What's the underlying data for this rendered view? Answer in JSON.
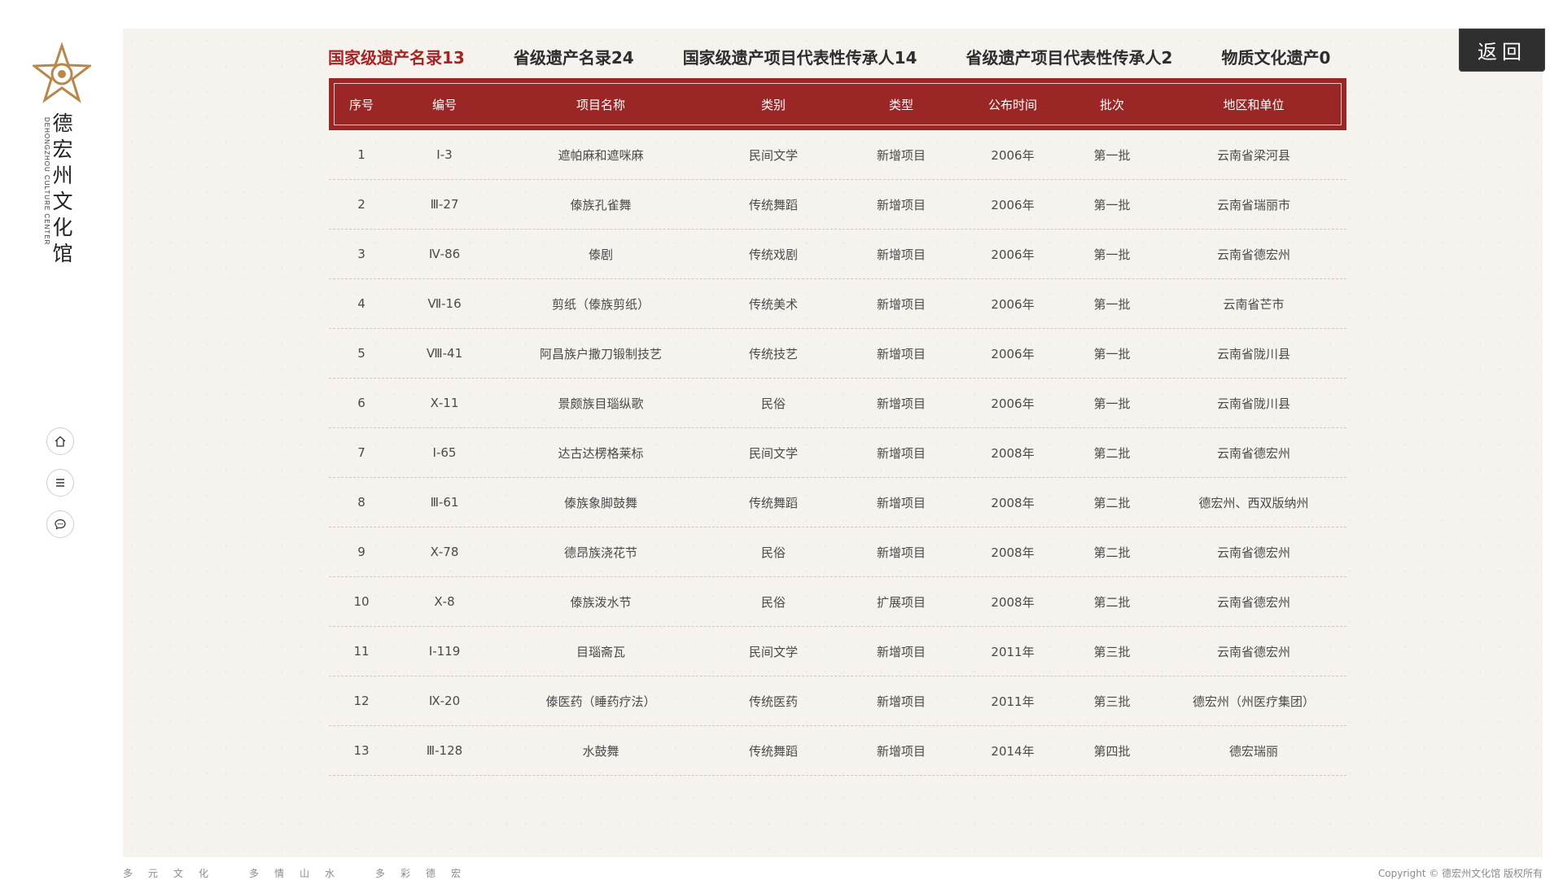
{
  "logo": {
    "name_cn": [
      "德",
      "宏",
      "州",
      "文",
      "化",
      "馆"
    ],
    "name_en": "DEHONGZHOU CULTURE CENTER"
  },
  "nav": [
    {
      "icon": "home-icon"
    },
    {
      "icon": "menu-icon"
    },
    {
      "icon": "chat-icon"
    }
  ],
  "tabs": [
    {
      "label": "国家级遗产名录13",
      "active": true
    },
    {
      "label": "省级遗产名录24",
      "active": false
    },
    {
      "label": "国家级遗产项目代表性传承人14",
      "active": false
    },
    {
      "label": "省级遗产项目代表性传承人2",
      "active": false
    },
    {
      "label": "物质文化遗产0",
      "active": false
    }
  ],
  "back_label": "返回",
  "table": {
    "headers": [
      "序号",
      "编号",
      "项目名称",
      "类别",
      "类型",
      "公布时间",
      "批次",
      "地区和单位"
    ],
    "rows": [
      [
        "1",
        "Ⅰ-3",
        "遮帕麻和遮咪麻",
        "民间文学",
        "新增项目",
        "2006年",
        "第一批",
        "云南省梁河县"
      ],
      [
        "2",
        "Ⅲ-27",
        "傣族孔雀舞",
        "传统舞蹈",
        "新增项目",
        "2006年",
        "第一批",
        "云南省瑞丽市"
      ],
      [
        "3",
        "Ⅳ-86",
        "傣剧",
        "传统戏剧",
        "新增项目",
        "2006年",
        "第一批",
        "云南省德宏州"
      ],
      [
        "4",
        "Ⅶ-16",
        "剪纸（傣族剪纸）",
        "传统美术",
        "新增项目",
        "2006年",
        "第一批",
        "云南省芒市"
      ],
      [
        "5",
        "Ⅷ-41",
        "阿昌族户撒刀锻制技艺",
        "传统技艺",
        "新增项目",
        "2006年",
        "第一批",
        "云南省陇川县"
      ],
      [
        "6",
        "Ⅹ-11",
        "景颇族目瑙纵歌",
        "民俗",
        "新增项目",
        "2006年",
        "第一批",
        "云南省陇川县"
      ],
      [
        "7",
        "Ⅰ-65",
        "达古达楞格莱标",
        "民间文学",
        "新增项目",
        "2008年",
        "第二批",
        "云南省德宏州"
      ],
      [
        "8",
        "Ⅲ-61",
        "傣族象脚鼓舞",
        "传统舞蹈",
        "新增项目",
        "2008年",
        "第二批",
        "德宏州、西双版纳州"
      ],
      [
        "9",
        "Ⅹ-78",
        "德昂族浇花节",
        "民俗",
        "新增项目",
        "2008年",
        "第二批",
        "云南省德宏州"
      ],
      [
        "10",
        "Ⅹ-8",
        "傣族泼水节",
        "民俗",
        "扩展项目",
        "2008年",
        "第二批",
        "云南省德宏州"
      ],
      [
        "11",
        "Ⅰ-119",
        "目瑙斋瓦",
        "民间文学",
        "新增项目",
        "2011年",
        "第三批",
        "云南省德宏州"
      ],
      [
        "12",
        "Ⅸ-20",
        "傣医药（睡药疗法）",
        "传统医药",
        "新增项目",
        "2011年",
        "第三批",
        "德宏州（州医疗集团）"
      ],
      [
        "13",
        "Ⅲ-128",
        "水鼓舞",
        "传统舞蹈",
        "新增项目",
        "2014年",
        "第四批",
        "德宏瑞丽"
      ]
    ]
  },
  "footer": {
    "slogan": "多元文化　多情山水　多彩德宏",
    "copyright": "Copyright © 德宏州文化馆 版权所有"
  },
  "colors": {
    "accent": "#9b2626",
    "active_tab": "#a52424",
    "paper": "#f6f3ee",
    "back_button": "#2f2f2f"
  }
}
